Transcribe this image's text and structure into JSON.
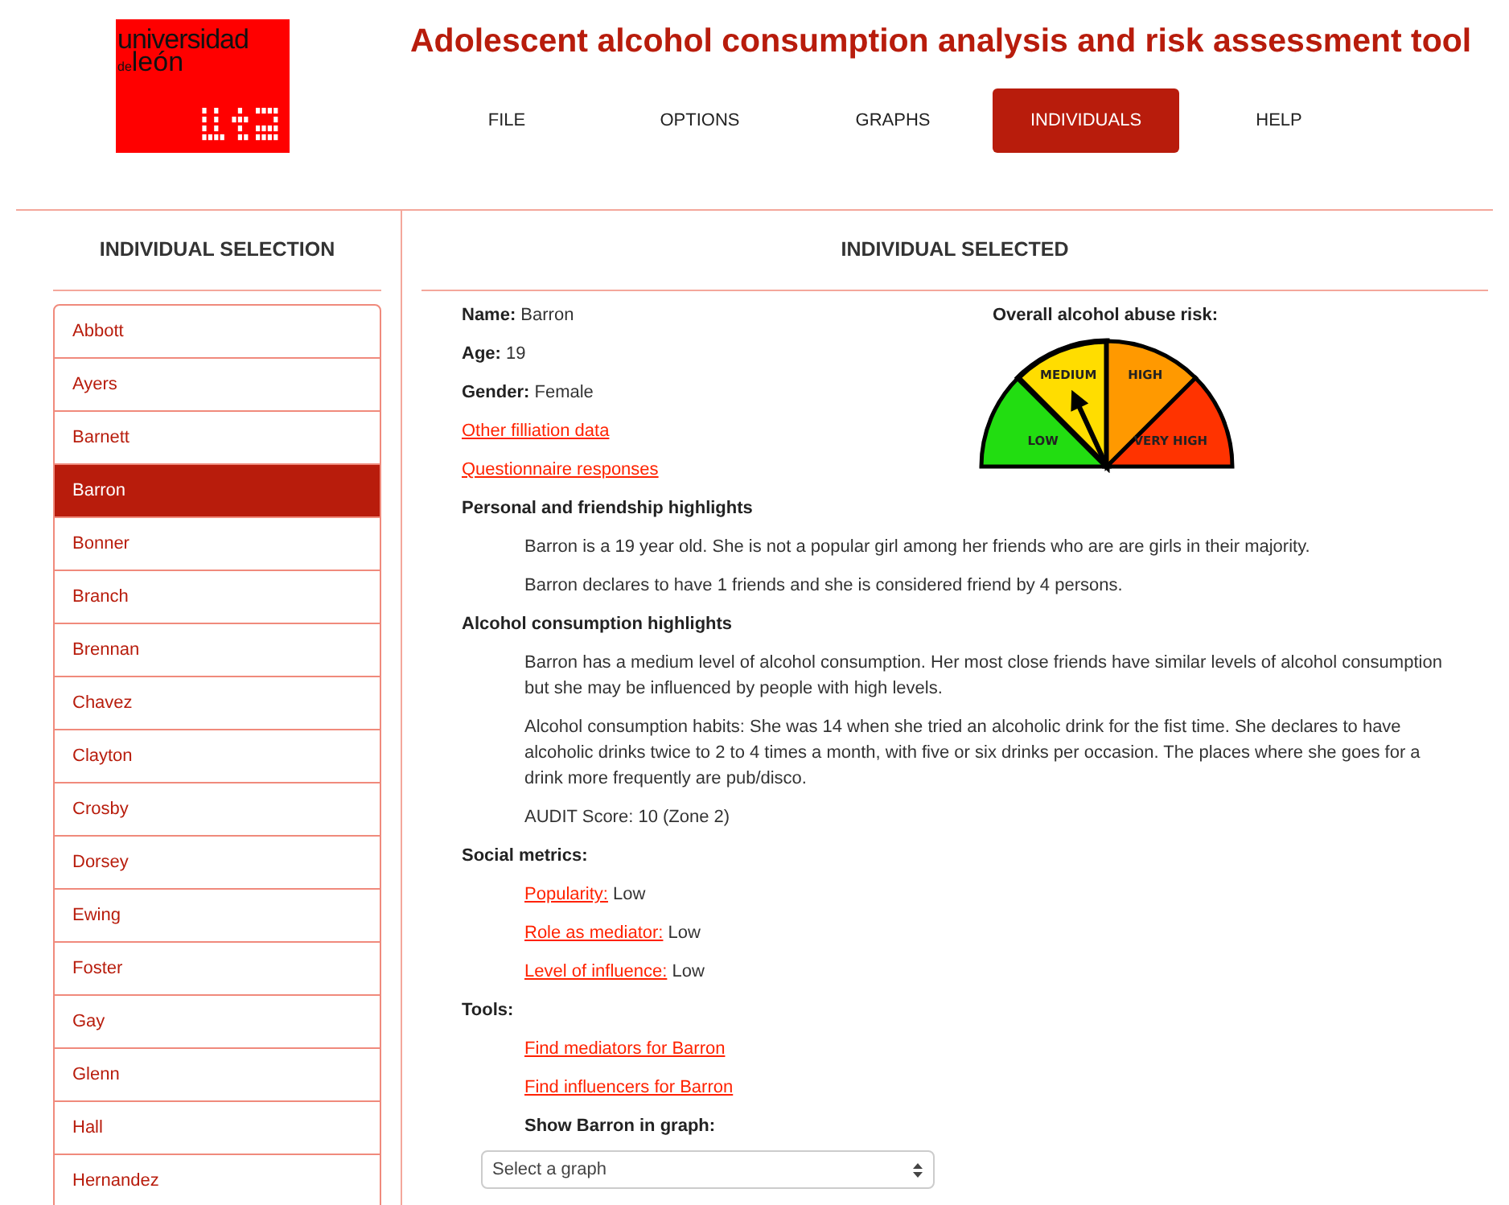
{
  "logo": {
    "line_1": "universidad",
    "line_2_small": "de",
    "line_2": "león"
  },
  "title": "Adolescent alcohol consumption analysis and risk assessment tool",
  "nav": [
    {
      "label": "FILE",
      "selected": false
    },
    {
      "label": "OPTIONS",
      "selected": false
    },
    {
      "label": "GRAPHS",
      "selected": false
    },
    {
      "label": "INDIVIDUALS",
      "selected": true
    },
    {
      "label": "HELP",
      "selected": false
    }
  ],
  "sidebar": {
    "heading": "INDIVIDUAL SELECTION",
    "items": [
      {
        "label": "Abbott",
        "selected": false
      },
      {
        "label": "Ayers",
        "selected": false
      },
      {
        "label": "Barnett",
        "selected": false
      },
      {
        "label": "Barron",
        "selected": true
      },
      {
        "label": "Bonner",
        "selected": false
      },
      {
        "label": "Branch",
        "selected": false
      },
      {
        "label": "Brennan",
        "selected": false
      },
      {
        "label": "Chavez",
        "selected": false
      },
      {
        "label": "Clayton",
        "selected": false
      },
      {
        "label": "Crosby",
        "selected": false
      },
      {
        "label": "Dorsey",
        "selected": false
      },
      {
        "label": "Ewing",
        "selected": false
      },
      {
        "label": "Foster",
        "selected": false
      },
      {
        "label": "Gay",
        "selected": false
      },
      {
        "label": "Glenn",
        "selected": false
      },
      {
        "label": "Hall",
        "selected": false
      },
      {
        "label": "Hernandez",
        "selected": false
      }
    ]
  },
  "detail": {
    "heading": "INDIVIDUAL SELECTED",
    "fields": [
      "**Name:** Barron",
      "**Age:** 19",
      "**Gender:** Female"
    ],
    "links": [
      "Other filliation data",
      "Questionnaire responses"
    ],
    "risk": {
      "title": "Overall alcohol abuse risk:",
      "segments": [
        {
          "label": "LOW",
          "color": "#22dd11",
          "selected": false
        },
        {
          "label": "MEDIUM",
          "color": "#ffdd00",
          "selected": true
        },
        {
          "label": "HIGH",
          "color": "#ff9900",
          "selected": false
        },
        {
          "label": "VERY HIGH",
          "color": "#ff3300",
          "selected": false
        }
      ]
    },
    "personal": {
      "heading": "Personal and friendship highlights",
      "paragraphs": [
        "Barron is a 19 year old. She is not a popular girl among her friends who are are girls in their majority.",
        "Barron declares to have 1 friends and she is considered friend by 4 persons."
      ]
    },
    "alcohol": {
      "heading": "Alcohol consumption highlights",
      "paragraphs": [
        "Barron has a medium level of alcohol consumption. Her most close friends have similar levels of alcohol consumption but she may be influenced by people with high levels.",
        "Alcohol consumption habits: She was 14 when she tried an alcoholic drink for the fist time. She declares to have alcoholic drinks twice to 2 to 4 times a month, with five or six drinks per occasion. The places where she goes for a drink more frequently are pub/disco.",
        "AUDIT Score: 10 (Zone 2)"
      ]
    },
    "social": {
      "heading": "Social metrics:",
      "metrics": [
        {
          "link": "Popularity:",
          "value": "Low"
        },
        {
          "link": "Role as mediator:",
          "value": "Low"
        },
        {
          "link": "Level of influence:",
          "value": "Low"
        }
      ]
    },
    "tools": {
      "heading": "Tools:",
      "links": [
        "Find mediators for Barron",
        "Find influencers for Barron"
      ],
      "graph_label": "Show Barron in graph:",
      "graph_select": {
        "value": "Select a graph"
      }
    }
  }
}
